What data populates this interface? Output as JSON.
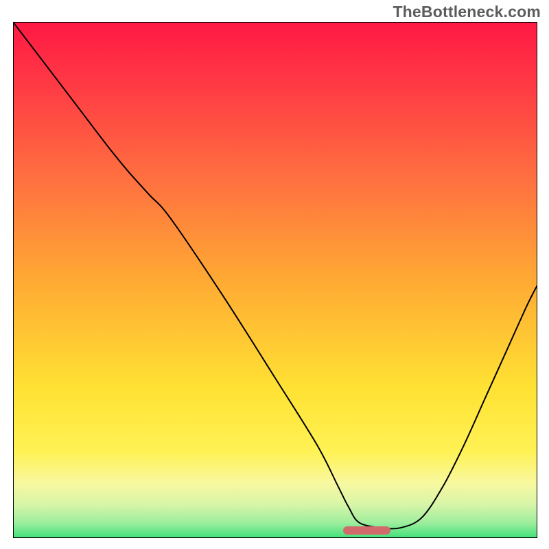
{
  "watermark": "TheBottleneck.com",
  "chart_data": {
    "type": "line",
    "title": "",
    "xlabel": "",
    "ylabel": "",
    "xlim": [
      0,
      100
    ],
    "ylim": [
      0,
      100
    ],
    "grid": false,
    "background": {
      "type": "vertical-gradient",
      "stops": [
        {
          "offset": 0.0,
          "color": "#ff1844"
        },
        {
          "offset": 0.12,
          "color": "#ff3a44"
        },
        {
          "offset": 0.3,
          "color": "#ff7040"
        },
        {
          "offset": 0.5,
          "color": "#ffac33"
        },
        {
          "offset": 0.7,
          "color": "#ffe233"
        },
        {
          "offset": 0.82,
          "color": "#fff255"
        },
        {
          "offset": 0.88,
          "color": "#f8f8a0"
        },
        {
          "offset": 0.92,
          "color": "#d8f5a8"
        },
        {
          "offset": 0.955,
          "color": "#9eee9e"
        },
        {
          "offset": 0.985,
          "color": "#3fe07a"
        },
        {
          "offset": 1.0,
          "color": "#20d268"
        }
      ]
    },
    "series": [
      {
        "name": "bottleneck-curve",
        "color": "#000000",
        "x": [
          0,
          6,
          12,
          18,
          22,
          26,
          30,
          40,
          50,
          58,
          62,
          64,
          66,
          70,
          74,
          78,
          82,
          86,
          90,
          94,
          98,
          100
        ],
        "y": [
          100,
          92,
          84,
          76,
          71,
          66.5,
          62,
          47,
          31,
          18,
          10,
          6,
          3,
          2,
          2,
          4,
          10,
          18,
          27,
          36,
          45,
          49
        ]
      }
    ],
    "annotations": [
      {
        "name": "optimal-range-marker",
        "type": "bar",
        "color": "#d26a6b",
        "x_start": 63,
        "x_end": 72,
        "y": 1.5
      }
    ]
  }
}
